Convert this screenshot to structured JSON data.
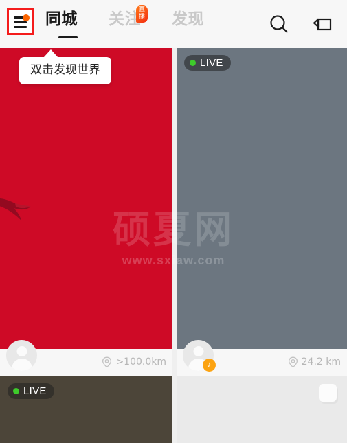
{
  "header": {
    "menu_icon": "hamburger-menu-icon",
    "menu_badge": "notification-dot",
    "tabs": [
      {
        "label": "同城",
        "active": true
      },
      {
        "label": "关注",
        "active": false,
        "badge": "直播"
      },
      {
        "label": "发现",
        "active": false
      }
    ],
    "search_icon": "search-icon",
    "camera_icon": "video-camera-icon",
    "background_color": "#f7f7f7"
  },
  "tooltip": {
    "text": "双击发现世界"
  },
  "feed": {
    "cards": [
      {
        "id": "card-red",
        "media_color": "#ce0a26",
        "distance": ">100.0km",
        "has_live": false,
        "has_avatar": true,
        "avatar_badge": false,
        "artwork": "swallow-bird-graphic"
      },
      {
        "id": "card-gray",
        "media_color": "#6c7680",
        "distance": "24.2 km",
        "has_live": true,
        "live_label": "LIVE",
        "has_avatar": true,
        "avatar_badge": true,
        "avatar_badge_icon": "music-note-icon"
      },
      {
        "id": "card-brown",
        "media_color": "#4c4539",
        "has_live": true,
        "live_label": "LIVE"
      },
      {
        "id": "card-light",
        "media_color": "#eaeaea",
        "has_live": false,
        "placeholder": "image-placeholder-tile"
      }
    ],
    "location_icon": "location-pin-icon"
  },
  "watermark": {
    "main": "硕夏网",
    "sub": "www.sxiaw.com"
  },
  "colors": {
    "accent_red": "#f41c1c",
    "badge_orange": "#fa6400",
    "live_green": "#3ecb2b",
    "avatar_badge": "#fca311",
    "page_bg": "#efefef"
  }
}
